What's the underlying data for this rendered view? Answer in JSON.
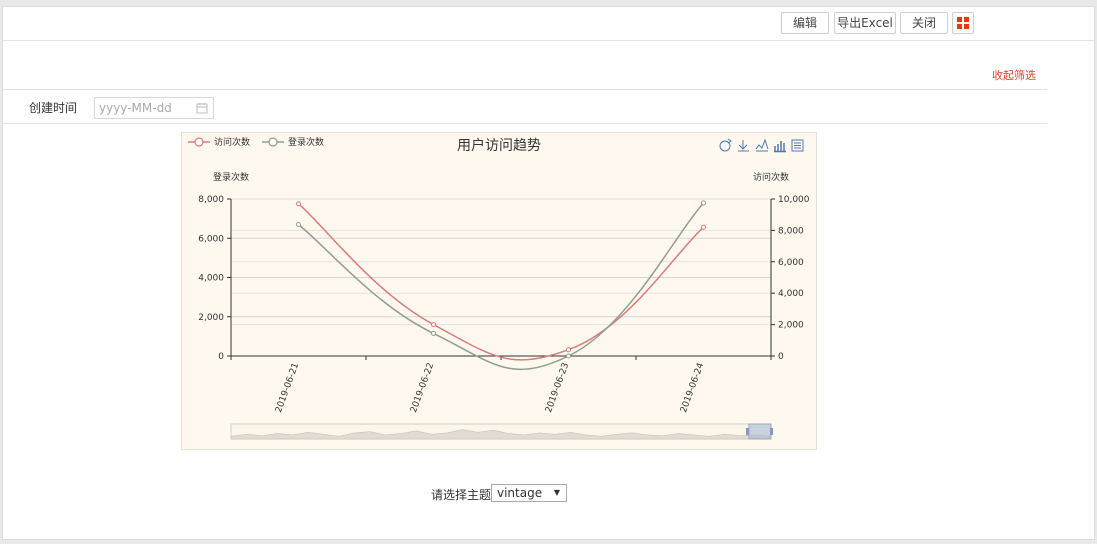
{
  "toolbar": {
    "edit_label": "编辑",
    "export_label": "导出Excel",
    "close_label": "关闭"
  },
  "filter": {
    "collapse_label": "收起筛选",
    "created_time_label": "创建时间",
    "date_placeholder": "yyyy-MM-dd"
  },
  "theme": {
    "label": "请选择主题",
    "selected": "vintage"
  },
  "colors": {
    "accent": "#e0452a",
    "series_visits": "#d87c7c",
    "series_logins": "#919e8b",
    "chart_bg": "#fef8ef"
  },
  "chart_data": {
    "type": "line",
    "title": "用户访问趋势",
    "legend_position": "top-left",
    "x": [
      "2019-06-21",
      "2019-06-22",
      "2019-06-23",
      "2019-06-24"
    ],
    "y_left": {
      "label": "登录次数",
      "ylim": [
        0,
        8000
      ],
      "ticks": [
        "0",
        "2,000",
        "4,000",
        "6,000",
        "8,000"
      ]
    },
    "y_right": {
      "label": "访问次数",
      "ylim": [
        0,
        10000
      ],
      "ticks": [
        "0",
        "2,000",
        "4,000",
        "6,000",
        "8,000",
        "10,000"
      ]
    },
    "series": [
      {
        "name": "访问次数",
        "axis": "right",
        "color": "#d87c7c",
        "values": [
          9700,
          2000,
          400,
          8200
        ]
      },
      {
        "name": "登录次数",
        "axis": "left",
        "color": "#919e8b",
        "values": [
          6700,
          1150,
          0,
          7800
        ]
      }
    ],
    "toolbox_icons": [
      "restore-icon",
      "save-image-icon",
      "line-type-icon",
      "bar-type-icon",
      "data-view-icon"
    ],
    "data_zoom": true,
    "grid": true
  }
}
